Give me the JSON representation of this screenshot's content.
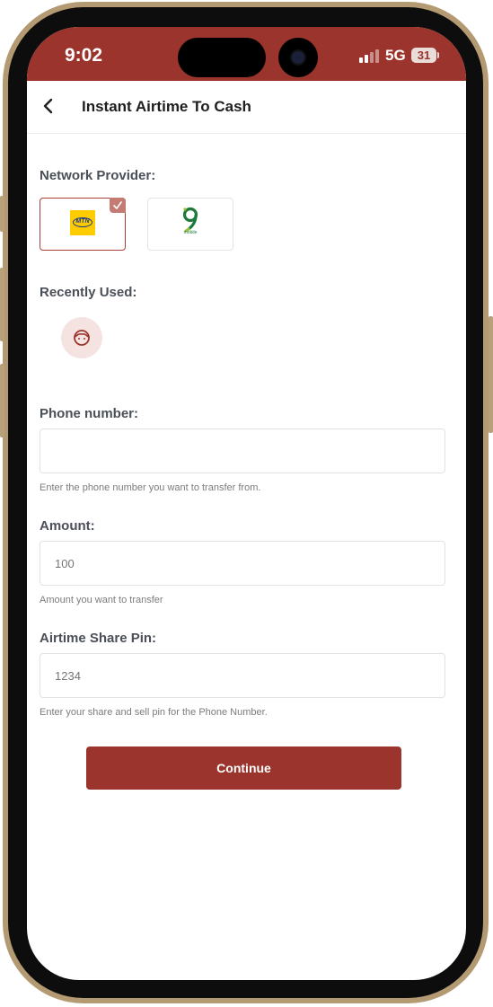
{
  "status_bar": {
    "time": "9:02",
    "network": "5G",
    "battery": "31"
  },
  "header": {
    "title": "Instant Airtime To Cash"
  },
  "network_provider": {
    "label": "Network Provider:",
    "providers": [
      {
        "name": "MTN",
        "logo_text": "MTN",
        "selected": true
      },
      {
        "name": "9mobile",
        "logo_text": "9",
        "logo_sub": "mobile",
        "selected": false
      }
    ]
  },
  "recently_used": {
    "label": "Recently Used:"
  },
  "phone": {
    "label": "Phone number:",
    "value": "",
    "placeholder": "",
    "hint": "Enter the phone number you want to transfer from."
  },
  "amount": {
    "label": "Amount:",
    "placeholder": "100",
    "hint": "Amount you want to transfer"
  },
  "pin": {
    "label": "Airtime Share Pin:",
    "placeholder": "1234",
    "hint": "Enter your share and sell pin for the Phone Number."
  },
  "actions": {
    "continue_label": "Continue"
  },
  "colors": {
    "accent": "#9b342c",
    "label_text": "#4a4f58",
    "hint_text": "#7c7c7c"
  }
}
